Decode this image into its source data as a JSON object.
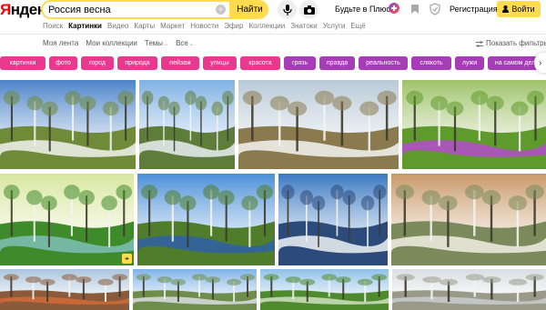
{
  "logo": {
    "first_letter": "Я",
    "rest": "ндекс"
  },
  "search": {
    "value": "Россия весна",
    "clear_label": "×",
    "button_label": "Найти"
  },
  "header": {
    "plus_label": "Будьте в Плюсе",
    "register_label": "Регистрация",
    "login_label": "Войти"
  },
  "service_tabs": [
    {
      "label": "Поиск",
      "active": false
    },
    {
      "label": "Картинки",
      "active": true
    },
    {
      "label": "Видео",
      "active": false
    },
    {
      "label": "Карты",
      "active": false
    },
    {
      "label": "Маркет",
      "active": false
    },
    {
      "label": "Новости",
      "active": false
    },
    {
      "label": "Эфир",
      "active": false
    },
    {
      "label": "Коллекции",
      "active": false
    },
    {
      "label": "Знатоки",
      "active": false
    },
    {
      "label": "Услуги",
      "active": false
    },
    {
      "label": "Ещё",
      "active": false
    }
  ],
  "submenu": {
    "my_feed": "Моя лента",
    "my_collections": "Мои коллекции",
    "themes": "Темы",
    "all": "Все",
    "show_filters": "Показать фильтры"
  },
  "tags": [
    {
      "label": "картинки",
      "color": "#e8398f"
    },
    {
      "label": "фото",
      "color": "#e8398f"
    },
    {
      "label": "город",
      "color": "#e8398f"
    },
    {
      "label": "природа",
      "color": "#e8398f"
    },
    {
      "label": "пейзаж",
      "color": "#e8398f"
    },
    {
      "label": "улицы",
      "color": "#e8398f"
    },
    {
      "label": "красота",
      "color": "#e8398f"
    },
    {
      "label": "грязь",
      "color": "#a63cb6"
    },
    {
      "label": "правда",
      "color": "#a63cb6"
    },
    {
      "label": "реальность",
      "color": "#a63cb6"
    },
    {
      "label": "слякоть",
      "color": "#a63cb6"
    },
    {
      "label": "лужи",
      "color": "#a63cb6"
    },
    {
      "label": "на самом деле",
      "color": "#a63cb6"
    }
  ],
  "tags_next_icon": "chevron-right-icon",
  "images": [
    {
      "name": "spring-field-snow-clouds",
      "sky": "#4b83c9",
      "ground": "#6f8b3a",
      "accent": "#f2f2ee"
    },
    {
      "name": "birches-flooded-meadow",
      "sky": "#7fb1e3",
      "ground": "#5e7c3a",
      "accent": "#e9eef2"
    },
    {
      "name": "birch-forest-melting-snow",
      "sky": "#b8c9d6",
      "ground": "#8a7a4e",
      "accent": "#f4f4f2"
    },
    {
      "name": "birch-grove-purple-flowers",
      "sky": "#9ec26a",
      "ground": "#5f9a2c",
      "accent": "#b54ccc"
    },
    {
      "name": "sunlit-trees-by-river",
      "sky": "#d9e6a0",
      "ground": "#3f8a2a",
      "accent": "#7ec0b6"
    },
    {
      "name": "tree-over-blue-lake",
      "sky": "#4a8fd8",
      "ground": "#4f7d2c",
      "accent": "#2e5fa8"
    },
    {
      "name": "forest-lake-spring-thaw",
      "sky": "#3a78c2",
      "ground": "#2c4b7a",
      "accent": "#eef2f6"
    },
    {
      "name": "white-flowers-sunset-lake",
      "sky": "#c99868",
      "ground": "#7a8a5a",
      "accent": "#f2efe6"
    },
    {
      "name": "forest-path-spring",
      "sky": "#a9c4dc",
      "ground": "#8a5a3a",
      "accent": "#d26b3a"
    },
    {
      "name": "birches-blue-sky",
      "sky": "#7fb2e6",
      "ground": "#6e8c4a",
      "accent": "#d8dde0"
    },
    {
      "name": "green-forest-clearing",
      "sky": "#8fc0e8",
      "ground": "#4e8a2e",
      "accent": "#cfe0c0"
    },
    {
      "name": "bare-birch-forest",
      "sky": "#d8dee2",
      "ground": "#9a9a8a",
      "accent": "#c8cccc"
    }
  ]
}
